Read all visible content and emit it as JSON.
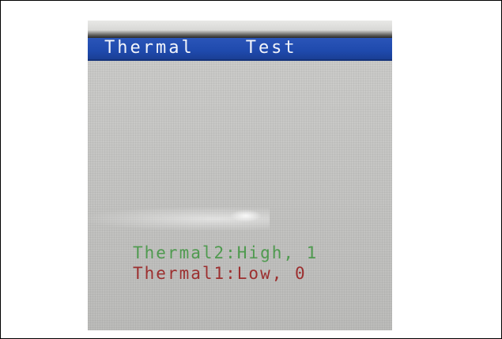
{
  "window": {
    "title": "Thermal    Test"
  },
  "status": {
    "thermal2_line": "Thermal2:High, 1",
    "thermal1_line": "Thermal1:Low, 0"
  },
  "colors": {
    "title_bar": "#1f4aad",
    "title_text": "#f2f4fa",
    "screen_background": "#c6c6c4",
    "high_text": "#4f9a4f",
    "low_text": "#9c2f2f"
  }
}
